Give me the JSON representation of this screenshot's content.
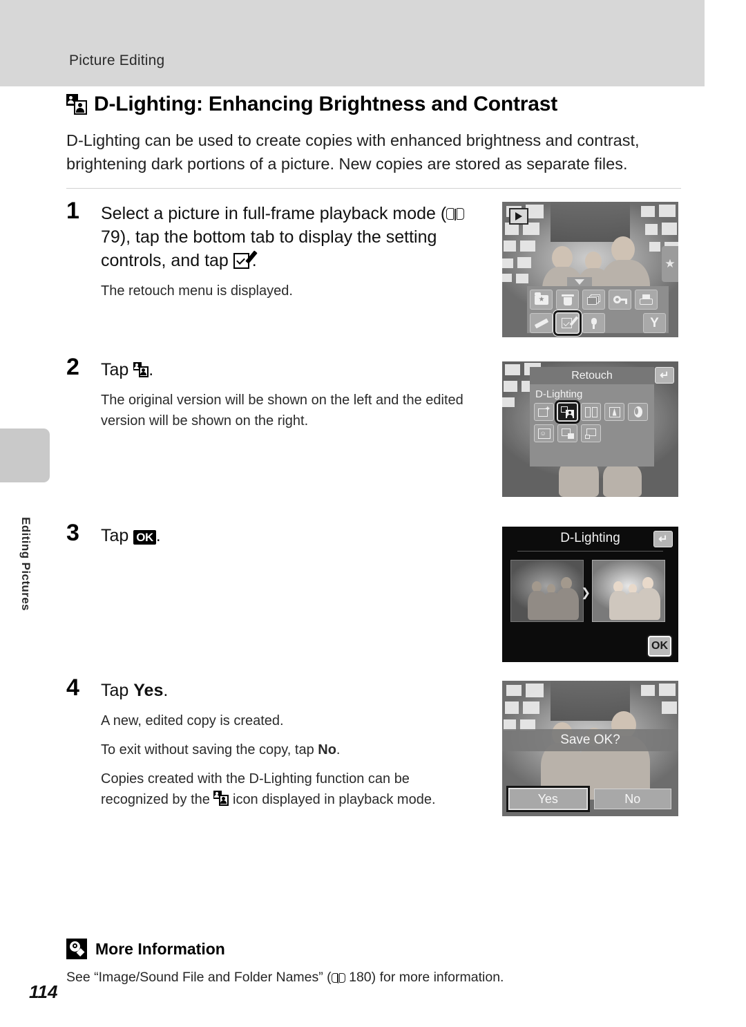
{
  "header": {
    "running_title": "Picture Editing"
  },
  "sidebar": {
    "chapter_label": "Editing Pictures"
  },
  "section": {
    "icon": "d-lighting-icon",
    "title": "D-Lighting: Enhancing Brightness and Contrast",
    "intro": "D-Lighting can be used to create copies with enhanced brightness and contrast, brightening dark portions of a picture. New copies are stored as separate files."
  },
  "steps": [
    {
      "number": "1",
      "head_pre": "Select a picture in full-frame playback mode (",
      "head_ref": "79",
      "head_mid": "), tap the bottom tab to display the setting controls, and tap ",
      "head_post": ".",
      "notes": [
        "The retouch menu is displayed."
      ]
    },
    {
      "number": "2",
      "head_pre": "Tap ",
      "head_post": ".",
      "notes": [
        "The original version will be shown on the left and the edited version will be shown on the right."
      ]
    },
    {
      "number": "3",
      "head_pre": "Tap ",
      "head_badge": "OK",
      "head_post": ".",
      "notes": []
    },
    {
      "number": "4",
      "head_pre": "Tap ",
      "head_bold": "Yes",
      "head_post": ".",
      "notes": [
        "A new, edited copy is created.",
        "To exit without saving the copy, tap No.",
        "Copies created with the D-Lighting function can be recognized by the  icon displayed in playback mode."
      ],
      "note2_pre": "To exit without saving the copy, tap ",
      "note2_bold": "No",
      "note2_post": ".",
      "note3_pre": "Copies created with the D-Lighting function can be recognized by the ",
      "note3_post": " icon displayed in playback mode."
    }
  ],
  "shots": {
    "step1": {
      "playback_badge": "playback-icon",
      "favorites_tab": "★",
      "toolbar_row1": [
        "favorites-folder-icon",
        "trash-icon",
        "slideshow-icon",
        "protect-key-icon",
        "print-order-icon"
      ],
      "toolbar_row2": [
        "paint-icon",
        "retouch-icon",
        "voice-memo-icon",
        "setup-wrench-icon"
      ],
      "selected": "retouch-icon"
    },
    "step2": {
      "menu_title": "Retouch",
      "menu_subtitle": "D-Lighting",
      "back_label": "↵",
      "items": [
        "quick-retouch-icon",
        "d-lighting-icon",
        "skin-softening-icon",
        "filter-effects-icon",
        "soft-focus-icon",
        "smart-portrait-icon",
        "small-picture-icon",
        "crop-icon"
      ],
      "selected_index": 1
    },
    "step3": {
      "title": "D-Lighting",
      "back_label": "↵",
      "arrow": "❯",
      "ok_label": "OK"
    },
    "step4": {
      "prompt": "Save OK?",
      "yes_label": "Yes",
      "no_label": "No",
      "selected": "Yes"
    }
  },
  "more_information": {
    "icon": "lightbulb-icon",
    "title": "More Information",
    "text_pre": "See “Image/Sound File and Folder Names” (",
    "text_ref": "180",
    "text_post": ") for more information."
  },
  "page_number": "114",
  "colors": {
    "header_band": "#d7d7d7",
    "sidebar_tab": "#c9c9c9",
    "rule": "#d0d0d0"
  }
}
